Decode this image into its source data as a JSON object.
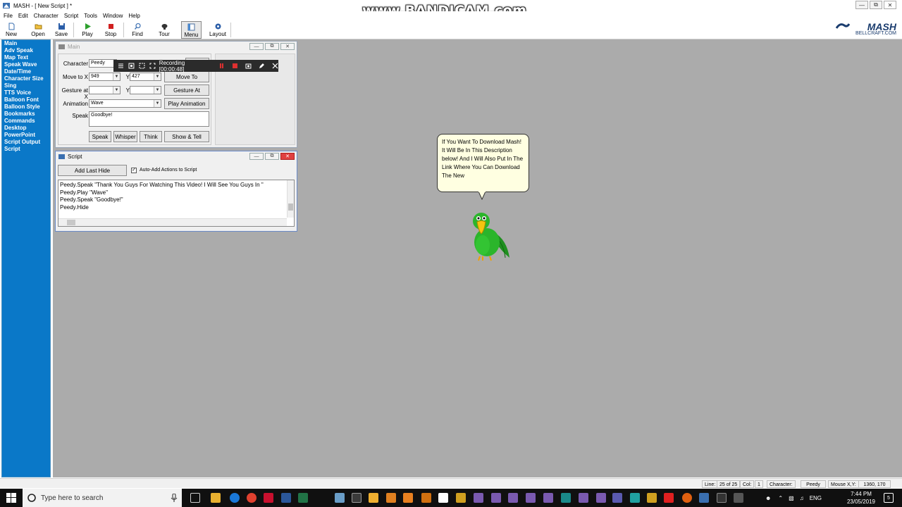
{
  "window": {
    "title": "MASH - [ New Script ] *",
    "watermark": "www.BANDICAM.com"
  },
  "menubar": [
    "File",
    "Edit",
    "Character",
    "Script",
    "Tools",
    "Window",
    "Help"
  ],
  "toolbar": {
    "buttons": [
      {
        "label": "New",
        "icon": "new-document-icon"
      },
      {
        "label": "Open",
        "icon": "open-folder-icon"
      },
      {
        "label": "Save",
        "icon": "save-disk-icon"
      },
      {
        "label": "Play",
        "icon": "play-icon"
      },
      {
        "label": "Stop",
        "icon": "stop-icon"
      },
      {
        "label": "Find",
        "icon": "find-icon"
      },
      {
        "label": "Tour",
        "icon": "tour-icon"
      },
      {
        "label": "Menu",
        "icon": "menu-icon"
      },
      {
        "label": "Layout",
        "icon": "layout-icon"
      }
    ],
    "logo": {
      "brand": "MASH",
      "sub": "BELLCRAFT.COM"
    }
  },
  "sidebar": {
    "items": [
      "Main",
      "Adv Speak",
      "Map Text",
      "Speak Wave",
      "Date/Time",
      "Character Size",
      "Sing",
      "TTS Voice",
      "Balloon Font",
      "Balloon Style",
      "Bookmarks",
      "Commands",
      "Desktop",
      "PowerPoint",
      "Script Output",
      "Script"
    ]
  },
  "main_window": {
    "title": "Main",
    "character_label": "Character",
    "character_value": "Peedy",
    "move_to_x_label": "Move to X",
    "move_to_x_value": "949",
    "move_to_y_label": "Y",
    "move_to_y_value": "427",
    "move_to_button": "Move To",
    "gesture_x_label": "Gesture at X",
    "gesture_x_value": "",
    "gesture_y_label": "Y",
    "gesture_y_value": "",
    "gesture_button": "Gesture At",
    "animation_label": "Animation",
    "animation_value": "Wave",
    "play_animation_button": "Play Animation",
    "speak_label": "Speak",
    "speak_value": "Goodbye!",
    "speak_button": "Speak",
    "whisper_button": "Whisper",
    "think_button": "Think",
    "show_tell_button": "Show & Tell"
  },
  "recording": {
    "text": "Recording [00:00:48]"
  },
  "script_window": {
    "title": "Script",
    "add_last_button": "Add Last Hide",
    "auto_add_label": "Auto-Add Actions to Script",
    "auto_add_checked": true,
    "lines": [
      "Peedy.Speak \"Thank You Guys For Watching This Video! I Will See You Guys In \"",
      "Peedy.Play \"Wave\"",
      "Peedy.Speak \"Goodbye!\"",
      "Peedy.Hide"
    ]
  },
  "balloon": {
    "text": "If You Want To Download Mash! It Will Be In This Description below! And I Will Also Put In The Link Where You Can Download The New"
  },
  "statusbar": {
    "line_label": "Line:",
    "line_value": "25 of 25",
    "col_label": "Col:",
    "col_value": "1",
    "character_label": "Character:",
    "character_value": "Peedy",
    "mouse_label": "Mouse X,Y:",
    "mouse_value": "1360, 170"
  },
  "taskbar": {
    "search_placeholder": "Type here to search",
    "language": "ENG",
    "time": "7:44 PM",
    "date": "23/05/2019",
    "notification_count": "5"
  },
  "colors": {
    "sidebar": "#0a78c8",
    "workspace": "#ababab",
    "balloon": "#ffffe1",
    "taskbar": "#101010"
  }
}
